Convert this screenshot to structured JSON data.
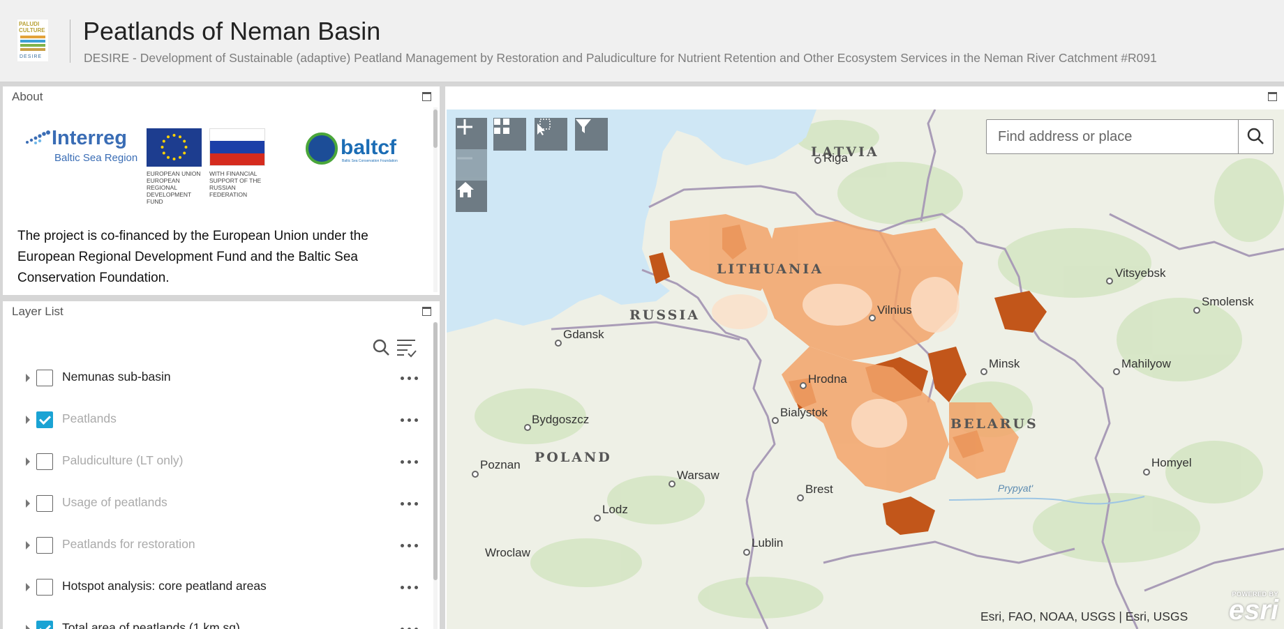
{
  "header": {
    "logo_lines": [
      "PALUDI",
      "CULTURE"
    ],
    "logo_bottom": "DESIRE",
    "title": "Peatlands of Neman Basin",
    "subtitle": "DESIRE - Development of Sustainable (adaptive) Peatland Management by Restoration and Paludiculture for Nutrient Retention and Other Ecosystem Services in the Neman River Catchment #R091"
  },
  "about": {
    "title": "About",
    "interreg_word": "Interreg",
    "interreg_sub": "Baltic Sea Region",
    "eu_text": "EUROPEAN UNION\nEUROPEAN REGIONAL DEVELOPMENT FUND",
    "ru_text": "WITH FINANCIAL SUPPORT OF THE RUSSIAN FEDERATION",
    "baltcf_word": "baltcf",
    "baltcf_small": "Baltic Sea Conservation Foundation",
    "text": "The project is co-financed by the European Union under the European Regional Development Fund and the Baltic Sea Conservation Foundation."
  },
  "layer_list": {
    "title": "Layer List",
    "layers": [
      {
        "label": "Nemunas sub-basin",
        "checked": false,
        "dim": false
      },
      {
        "label": "Peatlands",
        "checked": true,
        "dim": true
      },
      {
        "label": "Paludiculture (LT only)",
        "checked": false,
        "dim": true
      },
      {
        "label": "Usage of peatlands",
        "checked": false,
        "dim": true
      },
      {
        "label": "Peatlands for restoration",
        "checked": false,
        "dim": true
      },
      {
        "label": "Hotspot analysis: core peatland areas",
        "checked": false,
        "dim": false
      },
      {
        "label": "Total area of peatlands (1 km sq)",
        "checked": true,
        "dim": false
      }
    ]
  },
  "map": {
    "search_placeholder": "Find address or place",
    "attribution": "Esri, FAO, NOAA, USGS | Esri, USGS",
    "esri_powered": "POWERED BY",
    "esri_word": "esri",
    "countries": [
      "LATVIA",
      "LITHUANIA",
      "RUSSIA",
      "POLAND",
      "BELARUS"
    ],
    "cities": [
      "Riga",
      "Vilnius",
      "Gdansk",
      "Minsk",
      "Hrodna",
      "Bialystok",
      "Bydgoszcz",
      "Vitsyebsk",
      "Smolensk",
      "Mahilyow",
      "Poznan",
      "Warsaw",
      "Brest",
      "Homyel",
      "Lodz",
      "Lublin",
      "Wroclaw"
    ],
    "river": "Prypyat'",
    "colors": {
      "peat_dark": "#c2561a",
      "peat_light": "#f3a46a",
      "water": "#cfe7f5",
      "forest": "#d3e5c0",
      "border": "#a99cb7"
    }
  }
}
